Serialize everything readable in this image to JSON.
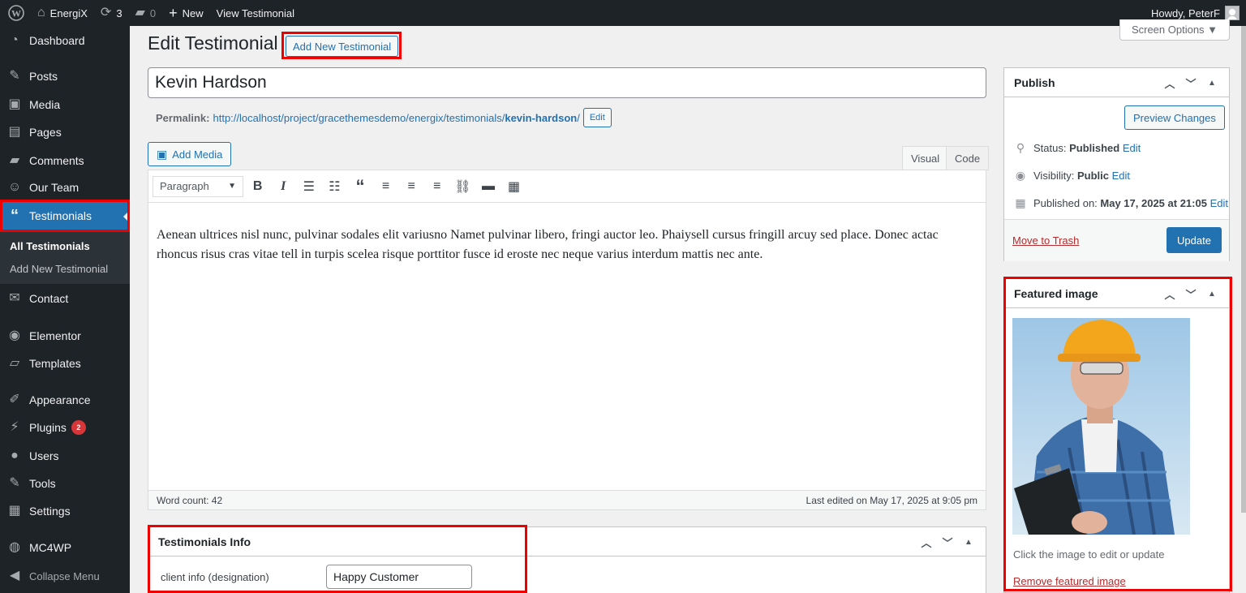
{
  "adminbar": {
    "site_name": "EnergiX",
    "updates_count": "3",
    "comments_count": "0",
    "new_label": "New",
    "view_label": "View Testimonial",
    "howdy": "Howdy, PeterF"
  },
  "sidebar": {
    "items": [
      {
        "label": "Dashboard",
        "icon": "dashboard-icon"
      },
      {
        "label": "Posts",
        "icon": "pin-icon"
      },
      {
        "label": "Media",
        "icon": "media-icon"
      },
      {
        "label": "Pages",
        "icon": "pages-icon"
      },
      {
        "label": "Comments",
        "icon": "comment-icon"
      },
      {
        "label": "Our Team",
        "icon": "team-icon"
      },
      {
        "label": "Testimonials",
        "icon": "quote-icon"
      },
      {
        "label": "Contact",
        "icon": "email-icon"
      },
      {
        "label": "Elementor",
        "icon": "elementor-icon"
      },
      {
        "label": "Templates",
        "icon": "folder-icon"
      },
      {
        "label": "Appearance",
        "icon": "brush-icon"
      },
      {
        "label": "Plugins",
        "icon": "plug-icon",
        "badge": "2"
      },
      {
        "label": "Users",
        "icon": "user-icon"
      },
      {
        "label": "Tools",
        "icon": "wrench-icon"
      },
      {
        "label": "Settings",
        "icon": "settings-icon"
      },
      {
        "label": "MC4WP",
        "icon": "mc4wp-icon"
      },
      {
        "label": "Collapse Menu",
        "icon": "collapse-icon"
      }
    ],
    "submenu": {
      "all": "All Testimonials",
      "add_new": "Add New Testimonial"
    }
  },
  "header": {
    "title": "Edit Testimonial",
    "add_new": "Add New Testimonial",
    "screen_options": "Screen Options ▼"
  },
  "post": {
    "title": "Kevin Hardson",
    "permalink_label": "Permalink:",
    "permalink_base": "http://localhost/project/gracethemesdemo/energix/testimonials/",
    "permalink_slug": "kevin-hardson",
    "permalink_tail": "/",
    "permalink_edit": "Edit"
  },
  "editor": {
    "add_media": "Add Media",
    "tab_visual": "Visual",
    "tab_code": "Code",
    "format": "Paragraph",
    "content": "Aenean ultrices nisl nunc, pulvinar sodales elit variusno Namet pulvinar libero, fringi auctor leo. Phaiysell cursus fringill arcuy sed place. Donec actac rhoncus risus cras vitae tell in turpis scelea risque porttitor fusce id eroste nec neque varius interdum mattis nec ante.",
    "word_count": "Word count: 42",
    "last_edited": "Last edited on May 17, 2025 at 9:05 pm"
  },
  "publish": {
    "title": "Publish",
    "preview": "Preview Changes",
    "status_label": "Status:",
    "status_value": "Published",
    "visibility_label": "Visibility:",
    "visibility_value": "Public",
    "published_label": "Published on:",
    "published_value": "May 17, 2025 at 21:05",
    "edit": "Edit",
    "trash": "Move to Trash",
    "update": "Update"
  },
  "featured": {
    "title": "Featured image",
    "hint": "Click the image to edit or update",
    "remove": "Remove featured image"
  },
  "testimonial_info": {
    "title": "Testimonials Info",
    "field_label": "client info (designation)",
    "field_value": "Happy Customer"
  },
  "colors": {
    "accent": "#2271b1",
    "sidebar_bg": "#1d2327",
    "highlight": "#ee0000"
  }
}
